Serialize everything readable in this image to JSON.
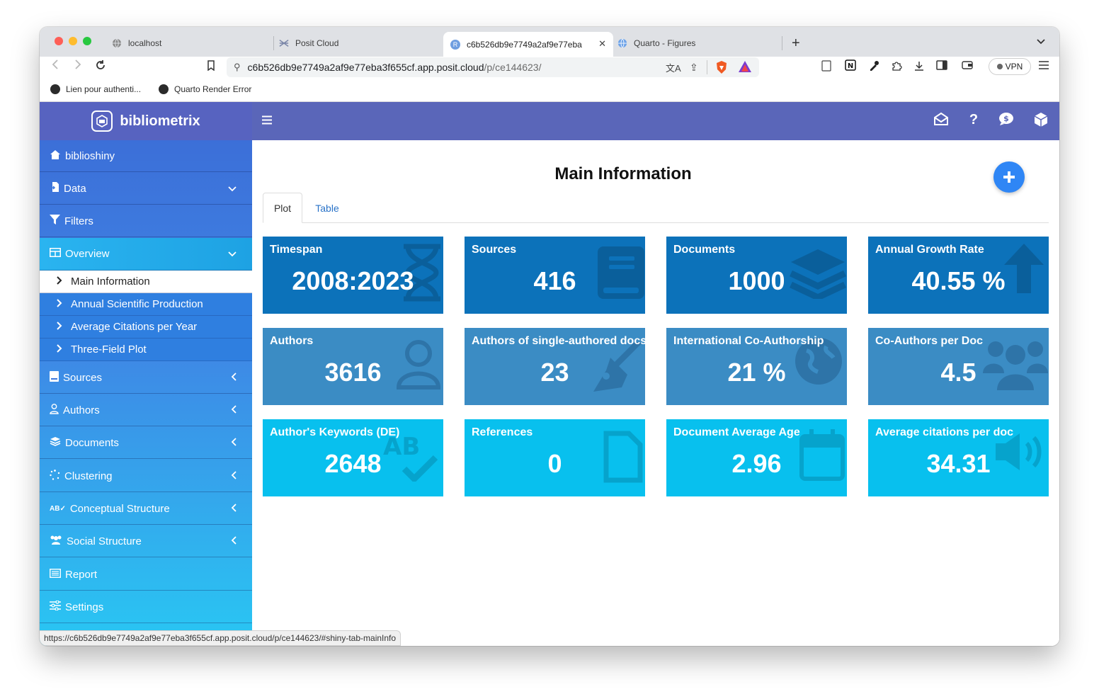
{
  "browser": {
    "tabs": [
      {
        "title": "localhost",
        "icon": "globe-icon"
      },
      {
        "title": "Posit Cloud",
        "icon": "posit-icon"
      },
      {
        "title": "c6b526db9e7749a2af9e77eba",
        "icon": "r-icon",
        "active": true
      },
      {
        "title": "Quarto - Figures",
        "icon": "globe-icon"
      }
    ],
    "url_host": "c6b526db9e7749a2af9e77eba3f655cf.app.posit.cloud",
    "url_path": "/p/ce144623/",
    "vpn_label": "VPN",
    "bookmarks": [
      {
        "label": "Lien pour authenti..."
      },
      {
        "label": "Quarto Render Error"
      }
    ],
    "status_url": "https://c6b526db9e7749a2af9e77eba3f655cf.app.posit.cloud/p/ce144623/#shiny-tab-mainInfo"
  },
  "app": {
    "brand": "bibliometrix",
    "header_icons": [
      "envelope-open-icon",
      "question-icon",
      "comment-dollar-icon",
      "cube-icon"
    ],
    "sidebar": {
      "items": [
        {
          "label": "biblioshiny",
          "icon": "home-icon"
        },
        {
          "label": "Data",
          "icon": "file-import-icon",
          "chevron": "down"
        },
        {
          "label": "Filters",
          "icon": "filter-icon"
        },
        {
          "label": "Overview",
          "icon": "table-icon",
          "chevron": "down",
          "active": true
        },
        {
          "label": "Sources",
          "icon": "book-icon",
          "chevron": "left"
        },
        {
          "label": "Authors",
          "icon": "user-icon",
          "chevron": "left"
        },
        {
          "label": "Documents",
          "icon": "layers-icon",
          "chevron": "left"
        },
        {
          "label": "Clustering",
          "icon": "spinner-icon",
          "chevron": "left"
        },
        {
          "label": "Conceptual Structure",
          "icon": "spell-check-icon",
          "chevron": "left"
        },
        {
          "label": "Social Structure",
          "icon": "users-icon",
          "chevron": "left"
        },
        {
          "label": "Report",
          "icon": "list-alt-icon"
        },
        {
          "label": "Settings",
          "icon": "sliders-icon"
        }
      ],
      "overview_sub": [
        {
          "label": "Main Information",
          "active": true
        },
        {
          "label": "Annual Scientific Production"
        },
        {
          "label": "Average Citations per Year"
        },
        {
          "label": "Three-Field Plot"
        }
      ]
    },
    "main": {
      "title": "Main Information",
      "tabs": [
        {
          "label": "Plot",
          "active": true
        },
        {
          "label": "Table"
        }
      ],
      "boxes": [
        {
          "label": "Timespan",
          "value": "2008:2023",
          "icon": "hourglass-icon",
          "color": "#0c72ba"
        },
        {
          "label": "Sources",
          "value": "416",
          "icon": "book-icon",
          "color": "#0c72ba"
        },
        {
          "label": "Documents",
          "value": "1000",
          "icon": "layer-group-icon",
          "color": "#0c72ba"
        },
        {
          "label": "Annual Growth Rate",
          "value": "40.55 %",
          "icon": "arrow-up-icon",
          "color": "#0c72ba"
        },
        {
          "label": "Authors",
          "value": "3616",
          "icon": "user-icon",
          "color": "#3b8cc4"
        },
        {
          "label": "Authors of single-authored docs",
          "value": "23",
          "icon": "pen-nib-icon",
          "color": "#3b8cc4"
        },
        {
          "label": "International Co-Authorship",
          "value": "21 %",
          "icon": "globe-icon",
          "color": "#3b8cc4"
        },
        {
          "label": "Co-Authors per Doc",
          "value": "4.5",
          "icon": "users-icon",
          "color": "#3b8cc4"
        },
        {
          "label": "Author's Keywords (DE)",
          "value": "2648",
          "icon": "spell-check-icon",
          "color": "#08c0ee"
        },
        {
          "label": "References",
          "value": "0",
          "icon": "file-icon",
          "color": "#08c0ee"
        },
        {
          "label": "Document Average Age",
          "value": "2.96",
          "icon": "calendar-icon",
          "color": "#08c0ee"
        },
        {
          "label": "Average citations per doc",
          "value": "34.31",
          "icon": "volume-icon",
          "color": "#08c0ee"
        }
      ]
    }
  }
}
